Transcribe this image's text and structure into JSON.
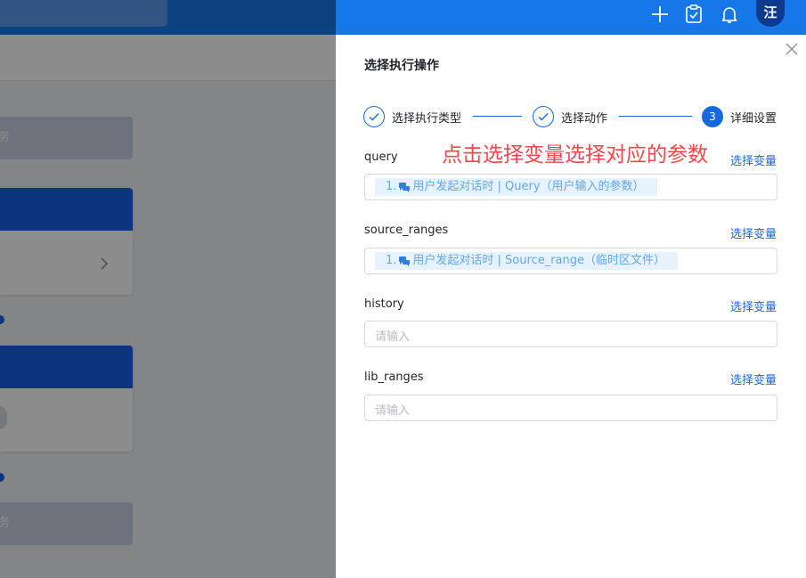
{
  "topbar": {
    "avatar_text": "汪",
    "icons": [
      "plus-icon",
      "clipboard-check-icon",
      "bell-icon"
    ]
  },
  "background": {
    "card_text_1": "务",
    "card_text_2": "务"
  },
  "drawer": {
    "title": "选择执行操作",
    "steps": [
      {
        "label": "选择执行类型",
        "state": "done"
      },
      {
        "label": "选择动作",
        "state": "done"
      },
      {
        "number": "3",
        "label": "详细设置",
        "state": "active"
      }
    ],
    "annotation": "点击选择变量选择对应的参数",
    "select_variable_label": "选择变量",
    "fields": [
      {
        "label": "query",
        "tag_index": "1.",
        "tag_text": "用户发起对话时 | Query（用户输入的参数）",
        "placeholder": ""
      },
      {
        "label": "source_ranges",
        "tag_index": "1.",
        "tag_text": "用户发起对话时 | Source_range（临时区文件）",
        "placeholder": ""
      },
      {
        "label": "history",
        "placeholder": "请输入"
      },
      {
        "label": "lib_ranges",
        "placeholder": "请输入"
      }
    ]
  },
  "colors": {
    "primary": "#1668dc",
    "topbar": "#1677e8",
    "annotation": "#f04848",
    "tag_bg": "#e6f2fd",
    "tag_text": "#63a7ea"
  }
}
